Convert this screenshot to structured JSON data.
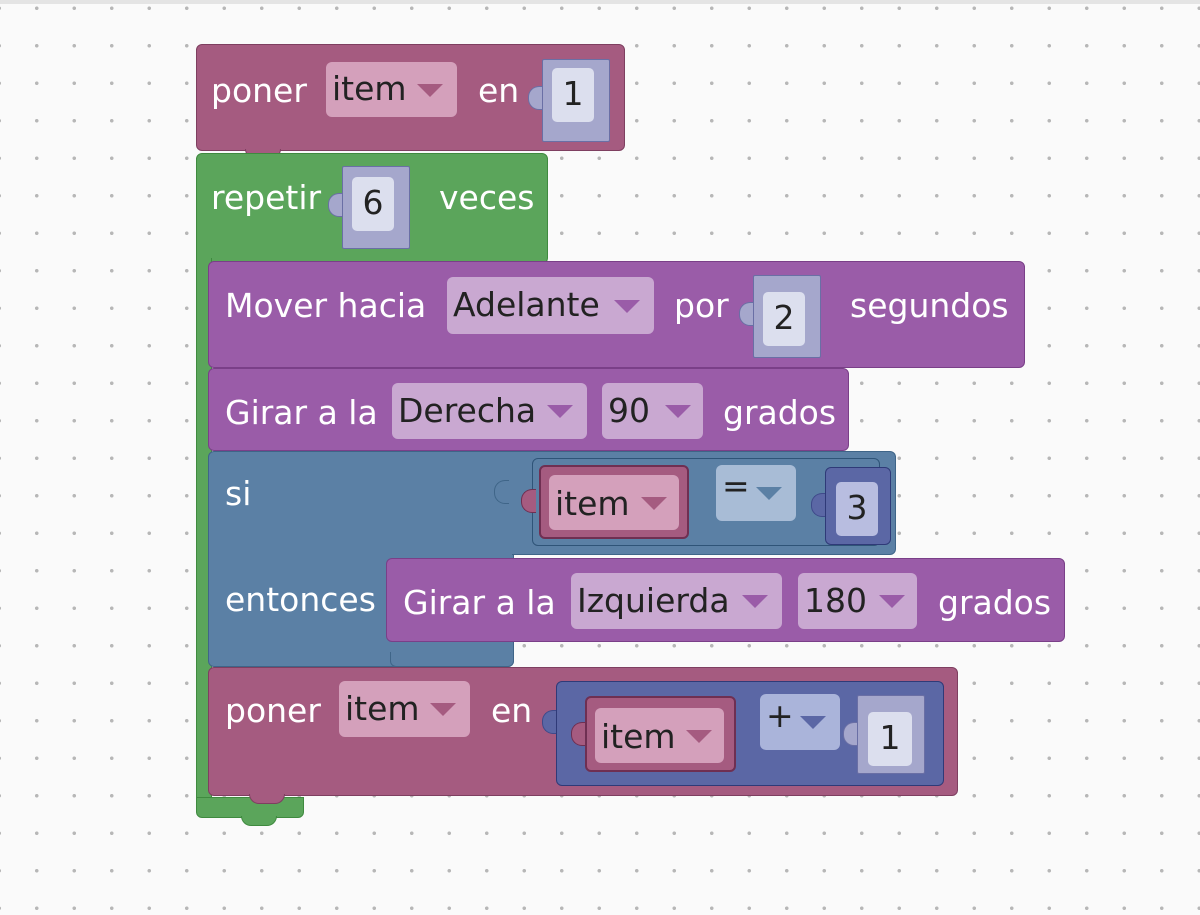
{
  "workspace": {
    "blocks": {
      "set1": {
        "kw": "poner",
        "var": "item",
        "kw2": "en",
        "value": "1"
      },
      "repeat": {
        "kw": "repetir",
        "times": "6",
        "kw2": "veces"
      },
      "move": {
        "kw": "Mover hacia",
        "dir": "Adelante",
        "kw2": "por",
        "secs": "2",
        "kw3": "segundos"
      },
      "turn1": {
        "kw": "Girar a la",
        "dir": "Derecha",
        "deg": "90",
        "kw2": "grados"
      },
      "if": {
        "kw_si": "si",
        "kw_entonces": "entonces",
        "compare": {
          "var": "item",
          "op": "=",
          "value": "3"
        },
        "turn2": {
          "kw": "Girar a la",
          "dir": "Izquierda",
          "deg": "180",
          "kw2": "grados"
        }
      },
      "set2": {
        "kw": "poner",
        "var": "item",
        "kw2": "en",
        "expr": {
          "var": "item",
          "op": "+",
          "value": "1"
        }
      }
    }
  },
  "colors": {
    "variables": "#a55b80",
    "loops": "#5ba55b",
    "motion": "#9a5ca8",
    "logic": "#5b80a5",
    "math": "#5b67a5",
    "background": "#fafafa"
  }
}
